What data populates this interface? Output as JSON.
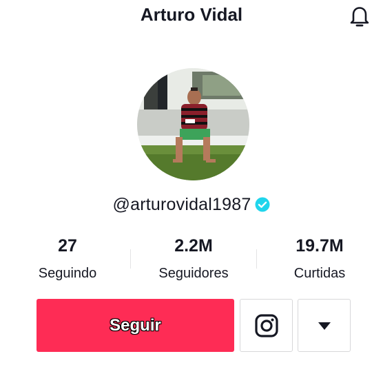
{
  "header": {
    "title": "Arturo Vidal",
    "bell_icon": "bell-icon"
  },
  "profile": {
    "username": "@arturovidal1987",
    "verified_icon": "verified-badge-icon",
    "verified_color": "#20d5ec"
  },
  "stats": [
    {
      "value": "27",
      "label": "Seguindo"
    },
    {
      "value": "2.2M",
      "label": "Seguidores"
    },
    {
      "value": "19.7M",
      "label": "Curtidas"
    }
  ],
  "actions": {
    "follow_label": "Seguir",
    "follow_color": "#fe2c55",
    "instagram_icon": "instagram-icon",
    "more_icon": "caret-down-icon"
  }
}
